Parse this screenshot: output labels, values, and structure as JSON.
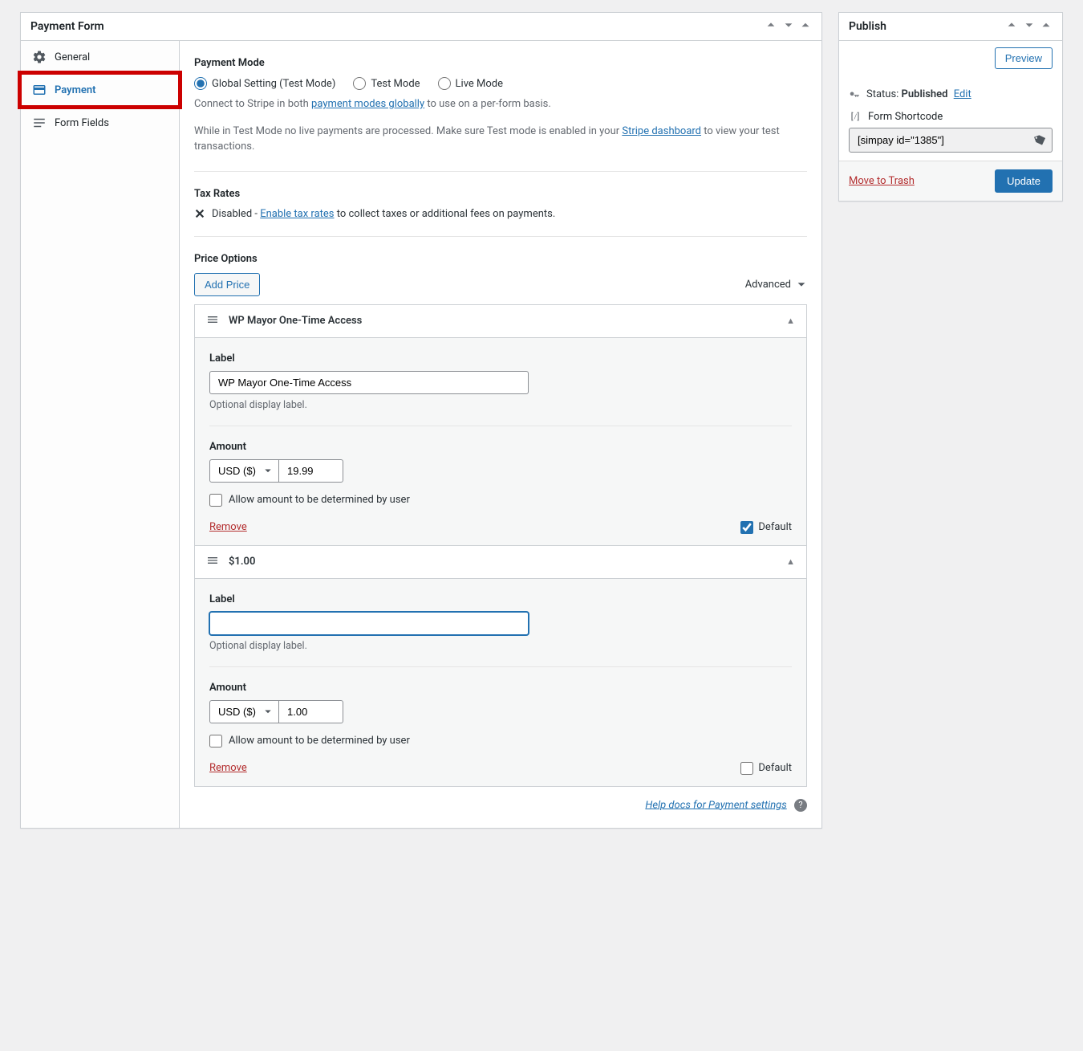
{
  "main": {
    "title": "Payment Form",
    "tabs": {
      "general": "General",
      "payment": "Payment",
      "form_fields": "Form Fields"
    },
    "payment_mode": {
      "heading": "Payment Mode",
      "options": {
        "global": "Global Setting (Test Mode)",
        "test": "Test Mode",
        "live": "Live Mode"
      },
      "help1_pre": "Connect to Stripe in both ",
      "help1_link": "payment modes globally",
      "help1_post": " to use on a per-form basis.",
      "help2_pre": "While in Test Mode no live payments are processed. Make sure Test mode is enabled in your ",
      "help2_link": "Stripe dashboard",
      "help2_post": " to view your test transactions."
    },
    "tax": {
      "heading": "Tax Rates",
      "disabled": "Disabled - ",
      "link": "Enable tax rates",
      "post": " to collect taxes or additional fees on payments."
    },
    "price": {
      "heading": "Price Options",
      "add_btn": "Add Price",
      "advanced": "Advanced",
      "label_heading": "Label",
      "label_hint": "Optional display label.",
      "amount_heading": "Amount",
      "currency": "USD ($)",
      "allow_user_amount": "Allow amount to be determined by user",
      "remove": "Remove",
      "default": "Default",
      "items": [
        {
          "title": "WP Mayor One-Time Access",
          "label_value": "WP Mayor One-Time Access",
          "amount": "19.99",
          "is_default": true,
          "label_focused": false
        },
        {
          "title": "$1.00",
          "label_value": "",
          "amount": "1.00",
          "is_default": false,
          "label_focused": true
        }
      ]
    },
    "help_docs": "Help docs for Payment settings"
  },
  "publish": {
    "title": "Publish",
    "preview": "Preview",
    "status_label": "Status: ",
    "status_value": "Published",
    "edit": "Edit",
    "shortcode_label": "Form Shortcode",
    "shortcode_value": "[simpay id=\"1385\"]",
    "trash": "Move to Trash",
    "update": "Update"
  }
}
